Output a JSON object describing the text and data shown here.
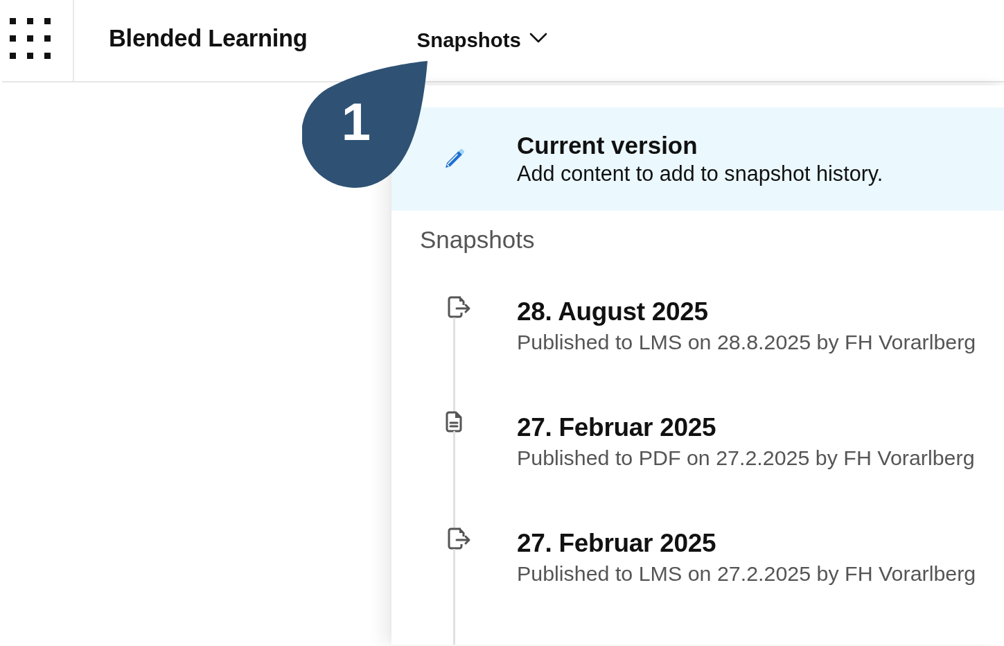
{
  "app_bar": {
    "title": "Blended Learning",
    "menu_label": "Snapshots"
  },
  "callout": {
    "label": "1"
  },
  "current_version": {
    "title": "Current version",
    "description": "Add content to add to snapshot history.",
    "selected": true
  },
  "snapshots": {
    "heading": "Snapshots",
    "items": [
      {
        "kind": "export",
        "title": "28. August 2025",
        "description": "Published to LMS on 28.8.2025 by FH Vorarlberg"
      },
      {
        "kind": "document",
        "title": "27. Februar 2025",
        "description": "Published to PDF on 27.2.2025 by FH Vorarlberg"
      },
      {
        "kind": "export",
        "title": "27. Februar 2025",
        "description": "Published to LMS on 27.2.2025 by FH Vorarlberg"
      }
    ]
  }
}
